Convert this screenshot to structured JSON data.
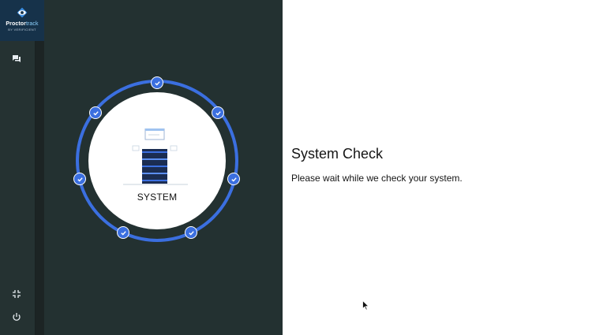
{
  "sidebar": {
    "logo": {
      "brand_bold": "Proctor",
      "brand_light": "track",
      "sub": "BY VERIFICIENT"
    },
    "icons": [
      {
        "name": "chat-icon"
      },
      {
        "name": "minimize-icon"
      },
      {
        "name": "power-icon"
      }
    ]
  },
  "system_check": {
    "step_label": "SYSTEM",
    "title": "System Check",
    "message": "Please wait while we check your system.",
    "completed_checks": 7
  },
  "colors": {
    "accent": "#3b6fe0",
    "panel": "#233131",
    "rail": "#253232",
    "content_bg": "#ffffff"
  }
}
